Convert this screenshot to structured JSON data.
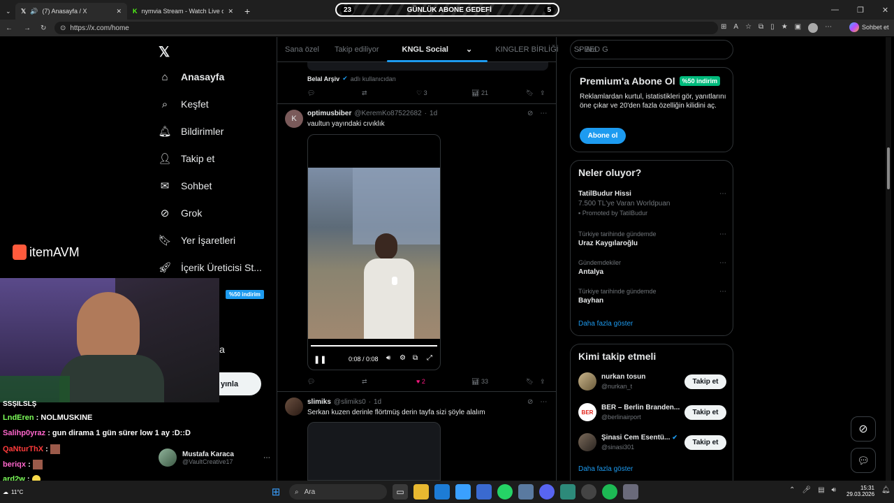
{
  "browser": {
    "tabs": [
      {
        "title": "(7) Anasayfa / X",
        "active": true
      },
      {
        "title": "nymvia Stream - Watch Live on Kic",
        "active": false
      }
    ],
    "url": "https://x.com/home",
    "chat_button": "Sohbet et"
  },
  "goal_bar": {
    "title": "GÜNLÜK ABONE GEDEFİ",
    "current": "23",
    "target": "5"
  },
  "sidebar": {
    "items": [
      {
        "label": "Anasayfa",
        "icon": "home-icon"
      },
      {
        "label": "Keşfet",
        "icon": "search-icon"
      },
      {
        "label": "Bildirimler",
        "icon": "bell-icon"
      },
      {
        "label": "Takip et",
        "icon": "person-add-icon"
      },
      {
        "label": "Sohbet",
        "icon": "mail-icon"
      },
      {
        "label": "Grok",
        "icon": "grok-icon"
      },
      {
        "label": "Yer İşaretleri",
        "icon": "bookmark-icon"
      },
      {
        "label": "İçerik Üreticisi St...",
        "icon": "rocket-icon"
      }
    ],
    "premium_badge": "%50 indirim",
    "partial_label": "a",
    "post_button_partial": "yınla",
    "account": {
      "name": "Mustafa Karaca",
      "handle": "@VaultCreative17"
    }
  },
  "overlay": {
    "brand": "itemAVM"
  },
  "feed": {
    "tabs": [
      "Sana özel",
      "Takip ediliyor",
      "KNGL Social",
      "KINGLER BİRLİĞİ",
      "SPEED G"
    ],
    "active_tab": "KNGL Social",
    "prev_post": {
      "source_name": "Belal Arşiv",
      "source_suffix": "adlı kullanıcıdan",
      "likes": "3",
      "views": "21"
    },
    "posts": [
      {
        "name": "optimusbiber",
        "handle": "@KeremKo87522682",
        "time": "1d",
        "text": "vaultun yayındaki cıvıklık",
        "avatar_letter": "K",
        "video_time": "0:08 / 0:08",
        "likes": "2",
        "views": "33"
      },
      {
        "name": "slimiks",
        "handle": "@slimiks0",
        "time": "1d",
        "text": "Serkan kuzen derinle flörtmüş derin tayfa sizi şöyle alalım"
      }
    ]
  },
  "right": {
    "search_placeholder": "Ara",
    "premium": {
      "title": "Premium'a Abone Ol",
      "badge": "%50 indirim",
      "text": "Reklamlardan kurtul, istatistikleri gör, yanıtlarını öne çıkar ve 20'den fazla özelliğin kilidini aç.",
      "button": "Abone ol"
    },
    "trends": {
      "title": "Neler oluyor?",
      "items": [
        {
          "category": "",
          "name": "TatilBudur Hissi",
          "sub": "7.500 TL'ye Varan Worldpuan",
          "promo": "Promoted by TatilBudur"
        },
        {
          "category": "Türkiye tarihinde gündemde",
          "name": "Uraz Kaygılaroğlu"
        },
        {
          "category": "Gündemdekiler",
          "name": "Antalya"
        },
        {
          "category": "Türkiye tarihinde gündemde",
          "name": "Bayhan"
        }
      ],
      "more": "Daha fazla göster"
    },
    "who_to_follow": {
      "title": "Kimi takip etmeli",
      "items": [
        {
          "name": "nurkan tosun",
          "handle": "@nurkan_t",
          "button": "Takip et"
        },
        {
          "name": "BER – Berlin Branden...",
          "handle": "@berlinairport",
          "button": "Takip et",
          "avatar_text": "BER"
        },
        {
          "name": "Şinasi Cem Esentü...",
          "handle": "@sinasi301",
          "button": "Takip et"
        }
      ],
      "more": "Daha fazla göster"
    }
  },
  "chat": {
    "lines": [
      {
        "user": "SSŞILSLŞ",
        "msg": "",
        "color": "#ffffff"
      },
      {
        "user": "LndEren",
        "msg": "NOLMUSKINE",
        "color": "#7dff5a"
      },
      {
        "user": "Salihp0yraz",
        "msg": "gun dirama 1 gün sürer low 1 ay :D::D",
        "color": "#ff66cc"
      },
      {
        "user": "QaNturThX",
        "msg": "",
        "color": "#ff3b3b"
      },
      {
        "user": "beriqx",
        "msg": "",
        "color": "#ff66cc"
      },
      {
        "user": "ard2w",
        "msg": "",
        "color": "#7dff5a"
      }
    ]
  },
  "taskbar": {
    "search": "Ara",
    "time": "15:31",
    "date": "29.03.2026",
    "temp": "11°C"
  }
}
